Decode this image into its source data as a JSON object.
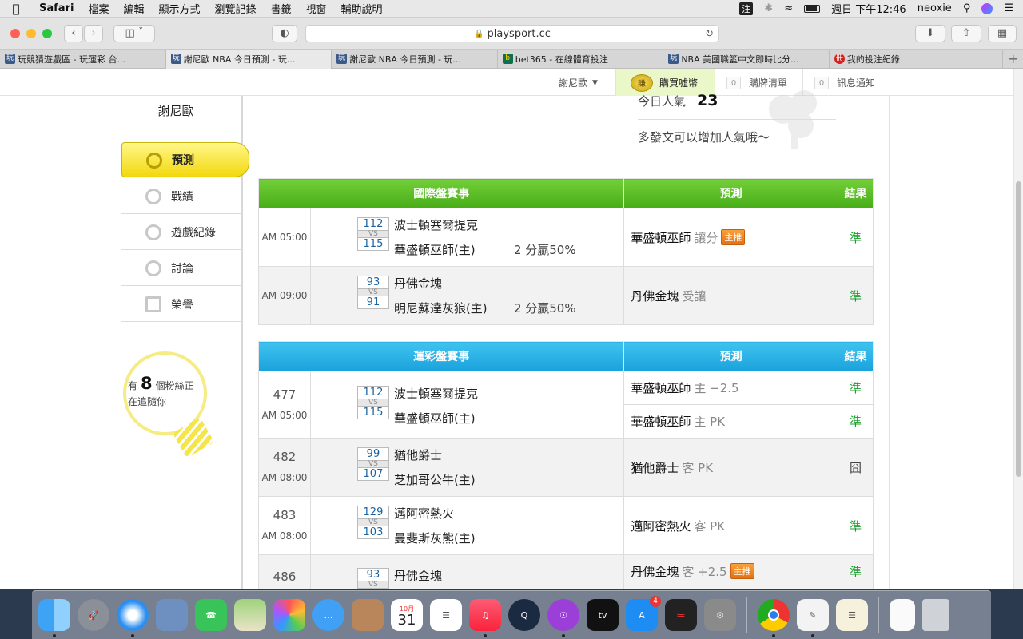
{
  "menubar": {
    "app": "Safari",
    "items": [
      "檔案",
      "編輯",
      "顯示方式",
      "瀏覽記錄",
      "書籤",
      "視窗",
      "輔助說明"
    ],
    "ime": "注",
    "clock": "週日 下午12:46",
    "user": "neoxie"
  },
  "toolbar": {
    "url": "playsport.cc"
  },
  "tabs": [
    {
      "title": "玩競猜遊戲區 - 玩運彩 台...",
      "icon": "playsport-icon"
    },
    {
      "title": "謝尼歐 NBA 今日預測 - 玩...",
      "icon": "playsport-icon"
    },
    {
      "title": "謝尼歐 NBA 今日預測 - 玩...",
      "icon": "playsport-icon"
    },
    {
      "title": "bet365 - 在線體育投注",
      "icon": "bet365-icon"
    },
    {
      "title": "NBA 美國職籃中文即時比分...",
      "icon": "playsport-icon"
    },
    {
      "title": "我的投注紀錄",
      "icon": "record-icon"
    }
  ],
  "topnav": {
    "user_menu": "謝尼歐",
    "buy_coin_icon": "賺",
    "buy_coin": "購買噓幣",
    "cart_count": "0",
    "cart": "購牌清單",
    "notice_count": "0",
    "notice": "訊息通知"
  },
  "sidebar": {
    "username": "謝尼歐",
    "items": [
      {
        "label": "預測",
        "icon": "target-icon"
      },
      {
        "label": "戰績",
        "icon": "record-icon"
      },
      {
        "label": "遊戲紀錄",
        "icon": "circle-icon"
      },
      {
        "label": "討論",
        "icon": "chat-icon"
      },
      {
        "label": "榮譽",
        "icon": "medal-icon"
      }
    ],
    "fans_prefix": "有",
    "fans_count": "8",
    "fans_suffix": "個粉絲正",
    "fans_line2": "在追隨你"
  },
  "popularity": {
    "label": "今日人氣",
    "value": "23",
    "message": "多發文可以增加人氣哦～"
  },
  "intl_table": {
    "headers": [
      "國際盤賽事",
      "預測",
      "結果"
    ],
    "rows": [
      {
        "time": "AM 05:00",
        "away_score": "112",
        "home_score": "115",
        "away": "波士頓塞爾提克",
        "home": "華盛頓巫師(主)",
        "rate": "2 分贏50%",
        "pick": "華盛頓巫師",
        "pick_type": "讓分",
        "badge": "主推",
        "result": "準"
      },
      {
        "time": "AM 09:00",
        "away_score": "93",
        "home_score": "91",
        "away": "丹佛金塊",
        "home": "明尼蘇達灰狼(主)",
        "rate": "2 分贏50%",
        "pick": "丹佛金塊",
        "pick_type": "受讓",
        "badge": "",
        "result": "準"
      }
    ]
  },
  "lottery_table": {
    "headers": [
      "運彩盤賽事",
      "預測",
      "結果"
    ],
    "vs": "VS",
    "rows": [
      {
        "no": "477",
        "time": "AM 05:00",
        "away_score": "112",
        "home_score": "115",
        "away": "波士頓塞爾提克",
        "home": "華盛頓巫師(主)",
        "picks": [
          {
            "team": "華盛頓巫師",
            "detail": "主 −2.5",
            "badge": "",
            "result": "準"
          },
          {
            "team": "華盛頓巫師",
            "detail": "主 PK",
            "badge": "",
            "result": "準"
          }
        ]
      },
      {
        "no": "482",
        "time": "AM 08:00",
        "away_score": "99",
        "home_score": "107",
        "away": "猶他爵士",
        "home": "芝加哥公牛(主)",
        "picks": [
          {
            "team": "猶他爵士",
            "detail": "客 PK",
            "badge": "",
            "result": "囧"
          }
        ]
      },
      {
        "no": "483",
        "time": "AM 08:00",
        "away_score": "129",
        "home_score": "103",
        "away": "邁阿密熱火",
        "home": "曼斐斯灰熊(主)",
        "picks": [
          {
            "team": "邁阿密熱火",
            "detail": "客 PK",
            "badge": "",
            "result": "準"
          }
        ]
      },
      {
        "no": "486",
        "time": "",
        "away_score": "93",
        "home_score": "",
        "away": "丹佛金塊",
        "home": "",
        "picks": [
          {
            "team": "丹佛金塊",
            "detail": "客 +2.5",
            "badge": "主推",
            "result": "準"
          }
        ]
      }
    ]
  },
  "dock": {
    "apps": [
      "Finder",
      "Launchpad",
      "Safari",
      "Preview",
      "FaceTime",
      "Maps",
      "Photos",
      "Messages",
      "Contacts",
      "Calendar",
      "Reminders",
      "Music",
      "QuickTime",
      "Podcasts",
      "TV",
      "App Store",
      "Voice Memos",
      "System Preferences",
      "Chrome",
      "TextEdit",
      "Notes",
      "Document",
      "Trash"
    ],
    "calendar_month": "10月",
    "calendar_day": "31",
    "appstore_badge": "4",
    "tv_label": "tv"
  }
}
